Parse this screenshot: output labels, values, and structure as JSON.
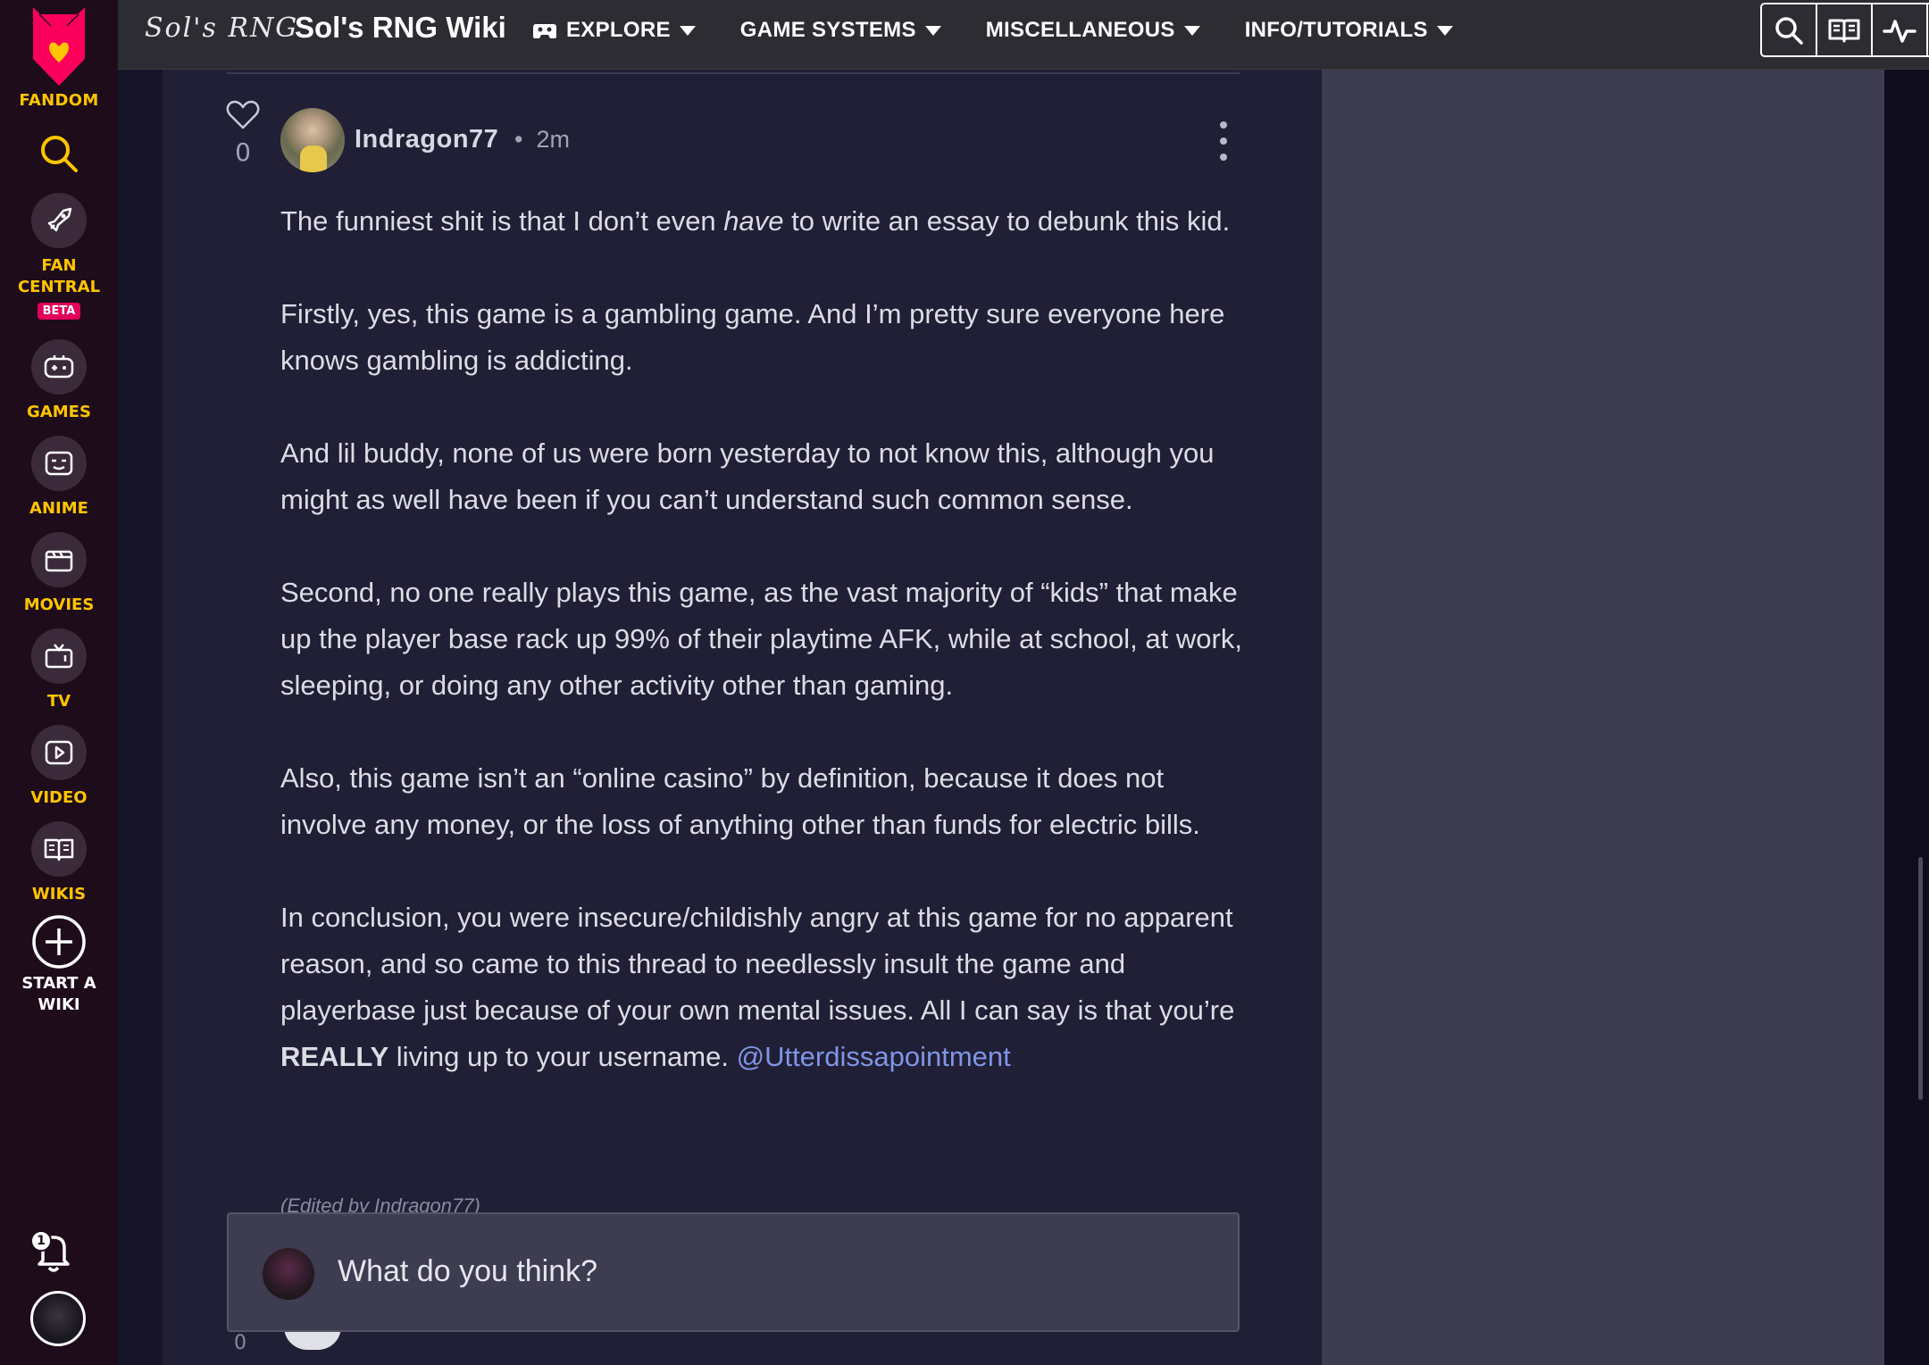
{
  "rail": {
    "fandom_label": "FANDOM",
    "items": [
      {
        "label": "FAN\nCENTRAL",
        "label_line1": "FAN",
        "label_line2": "CENTRAL",
        "badge": "BETA",
        "icon": "rocket-icon"
      },
      {
        "label": "GAMES",
        "icon": "gamepad-icon"
      },
      {
        "label": "ANIME",
        "icon": "anime-face-icon"
      },
      {
        "label": "MOVIES",
        "icon": "clapperboard-icon"
      },
      {
        "label": "TV",
        "icon": "tv-icon"
      },
      {
        "label": "VIDEO",
        "icon": "play-icon"
      },
      {
        "label": "WIKIS",
        "icon": "book-icon"
      }
    ],
    "start_line1": "START A",
    "start_line2": "WIKI",
    "notification_count": "1",
    "accent_color": "#ffc500"
  },
  "header": {
    "wiki_logo_text": "Sol's RNG",
    "wiki_name": "Sol's RNG Wiki",
    "nav": [
      {
        "label": "EXPLORE"
      },
      {
        "label": "GAME SYSTEMS"
      },
      {
        "label": "MISCELLANEOUS"
      },
      {
        "label": "INFO/TUTORIALS"
      }
    ],
    "tools": [
      "search-icon",
      "book-icon",
      "activity-icon",
      "theme-icon",
      "more-icon"
    ]
  },
  "comment": {
    "likes": "0",
    "author": "Indragon77",
    "separator": "•",
    "time": "2m",
    "paragraphs": {
      "p1_pre": "The funniest shit is that I don’t even ",
      "p1_em": "have",
      "p1_post": " to write an essay to debunk this kid.",
      "p2": "Firstly, yes, this game is a gambling game. And I’m pretty sure everyone here knows gambling is addicting.",
      "p3": "And lil buddy, none of us were born yesterday to not know this, although you might as well have been if you can’t understand such common sense.",
      "p4": "Second, no one really plays this game, as the vast majority of “kids” that make up the player base rack up 99% of their playtime AFK, while at school, at work, sleeping, or doing any other activity other than gaming.",
      "p5": "Also, this game isn’t an “online casino” by definition, because it does not involve any money, or the loss of anything other than funds for electric bills.",
      "p6_pre": "In conclusion, you were insecure/childishly angry at this game for no apparent reason, and so came to this thread to needlessly insult the game and playerbase just because of your own mental issues. All I can say is that you’re ",
      "p6_bold": "REALLY",
      "p6_post": " living up to your username. ",
      "mention": "@Utterdissapointment"
    },
    "edited_note": "(Edited by Indragon77)"
  },
  "reply_box": {
    "placeholder": "What do you think?"
  },
  "next_comment": {
    "likes": "0"
  }
}
